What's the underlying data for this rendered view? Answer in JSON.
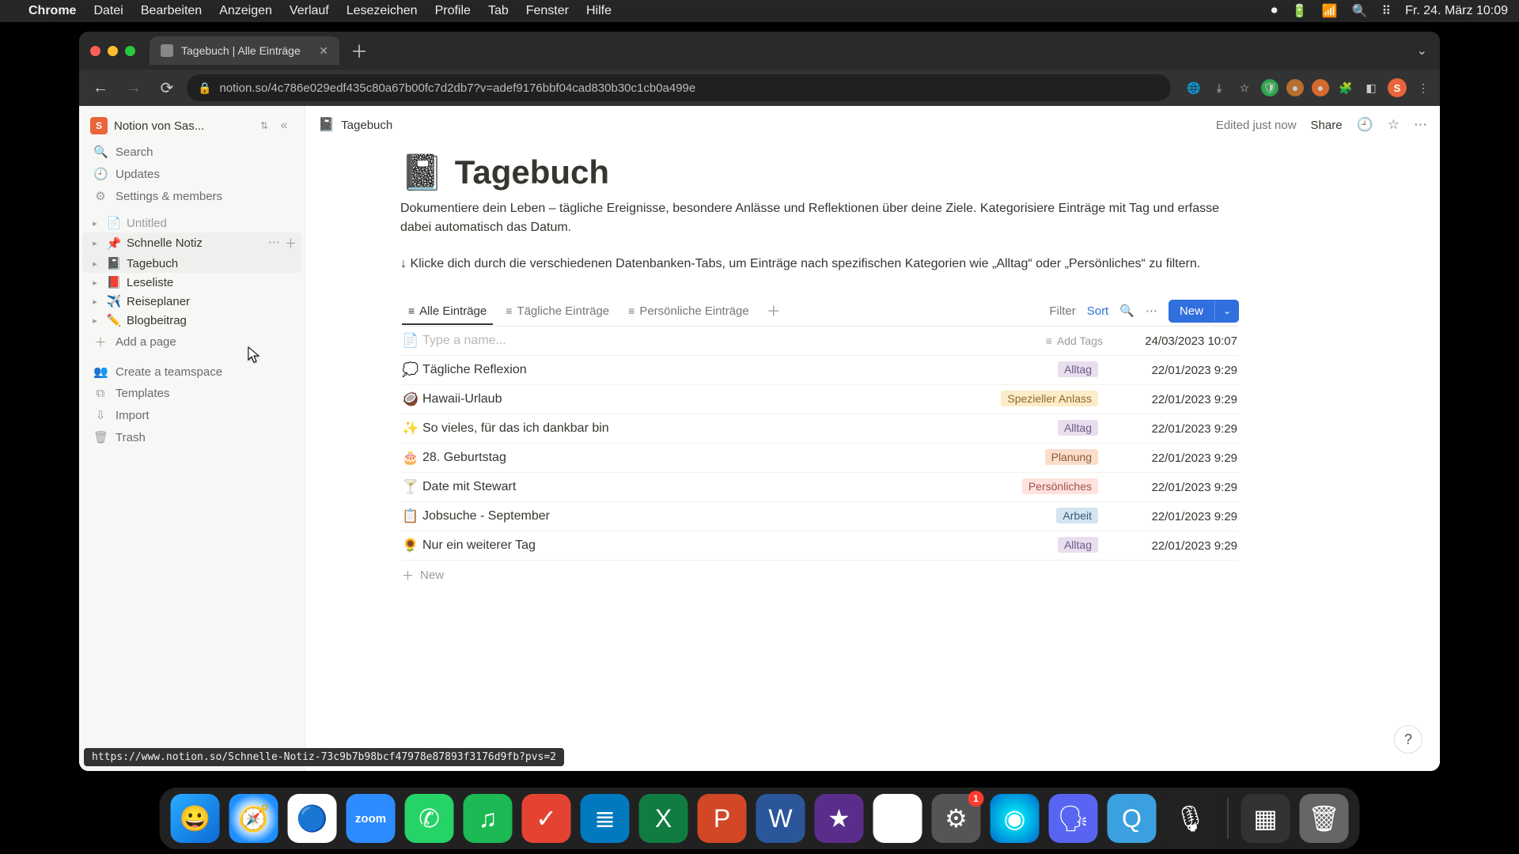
{
  "menubar": {
    "app": "Chrome",
    "items": [
      "Datei",
      "Bearbeiten",
      "Anzeigen",
      "Verlauf",
      "Lesezeichen",
      "Profile",
      "Tab",
      "Fenster",
      "Hilfe"
    ],
    "clock": "Fr. 24. März  10:09"
  },
  "browser": {
    "tab_title": "Tagebuch | Alle Einträge",
    "url": "notion.so/4c786e029edf435c80a67b00fc7d2db7?v=adef9176bbf04cad830b30c1cb0a499e",
    "avatar_initial": "S"
  },
  "workspace": {
    "badge": "S",
    "name": "Notion von Sas..."
  },
  "sidebar_top": [
    {
      "icon": "🔍",
      "label": "Search"
    },
    {
      "icon": "🕘",
      "label": "Updates"
    },
    {
      "icon": "⚙",
      "label": "Settings & members"
    }
  ],
  "sidebar_pages": [
    {
      "icon": "📄",
      "label": "Untitled",
      "muted": true
    },
    {
      "icon": "📌",
      "label": "Schnelle Notiz",
      "hovered": true
    },
    {
      "icon": "📓",
      "label": "Tagebuch",
      "active": true
    },
    {
      "icon": "📕",
      "label": "Leseliste"
    },
    {
      "icon": "✈️",
      "label": "Reiseplaner"
    },
    {
      "icon": "✏️",
      "label": "Blogbeitrag"
    }
  ],
  "sidebar_add_page": "Add a page",
  "sidebar_bottom": [
    {
      "icon": "👥",
      "label": "Create a teamspace"
    },
    {
      "icon": "⧉",
      "label": "Templates"
    },
    {
      "icon": "⇩",
      "label": "Import"
    },
    {
      "icon": "🗑",
      "label": "Trash"
    }
  ],
  "sidebar_newpage": "New page",
  "topbar": {
    "crumb_icon": "📓",
    "crumb": "Tagebuch",
    "edited": "Edited just now",
    "share": "Share"
  },
  "page": {
    "emoji": "📓",
    "title": "Tagebuch",
    "desc": "Dokumentiere dein Leben – tägliche Ereignisse, besondere Anlässe und Reflektionen über deine Ziele. Kategorisiere Einträge mit Tag und erfasse dabei automatisch das Datum.",
    "tip": "↓ Klicke dich durch die verschiedenen Datenbanken-Tabs, um Einträge nach spezifischen Kategorien wie „Alltag“ oder „Persönliches“ zu filtern."
  },
  "db": {
    "tabs": [
      {
        "icon": "≡",
        "label": "Alle Einträge",
        "active": true
      },
      {
        "icon": "≡",
        "label": "Tägliche Einträge"
      },
      {
        "icon": "≡",
        "label": "Persönliche Einträge"
      }
    ],
    "controls": {
      "filter": "Filter",
      "sort": "Sort",
      "new": "New"
    },
    "placeholder": "Type a name...",
    "addtags": "Add Tags",
    "newrow": "New",
    "rows": [
      {
        "icon": "📄",
        "title": "",
        "tags": [],
        "date": "24/03/2023 10:07",
        "placeholder": true
      },
      {
        "icon": "💭",
        "title": "Tägliche Reflexion",
        "tags": [
          "Alltag"
        ],
        "date": "22/01/2023 9:29"
      },
      {
        "icon": "🥥",
        "title": "Hawaii-Urlaub",
        "tags": [
          "Spezieller Anlass"
        ],
        "date": "22/01/2023 9:29"
      },
      {
        "icon": "✨",
        "title": "So vieles, für das ich dankbar bin",
        "tags": [
          "Alltag"
        ],
        "date": "22/01/2023 9:29"
      },
      {
        "icon": "🎂",
        "title": "28. Geburtstag",
        "tags": [
          "Planung"
        ],
        "date": "22/01/2023 9:29"
      },
      {
        "icon": "🍸",
        "title": "Date mit Stewart",
        "tags": [
          "Persönliches"
        ],
        "date": "22/01/2023 9:29"
      },
      {
        "icon": "📋",
        "title": "Jobsuche - September",
        "tags": [
          "Arbeit"
        ],
        "date": "22/01/2023 9:29"
      },
      {
        "icon": "🌻",
        "title": "Nur ein weiterer Tag",
        "tags": [
          "Alltag"
        ],
        "date": "22/01/2023 9:29"
      }
    ]
  },
  "status_url": "https://www.notion.so/Schnelle-Notiz-73c9b7b98bcf47978e87893f3176d9fb?pvs=2",
  "dock": [
    {
      "name": "finder",
      "color": "linear-gradient(135deg,#29abff,#0c6bd6)",
      "glyph": "😀"
    },
    {
      "name": "safari",
      "color": "radial-gradient(circle,#fff 30%,#1e90ff 70%)",
      "glyph": "🧭"
    },
    {
      "name": "chrome",
      "color": "#fff",
      "glyph": "🔵"
    },
    {
      "name": "zoom",
      "color": "#2d8cff",
      "glyph": "zoom",
      "text": true
    },
    {
      "name": "whatsapp",
      "color": "#25d366",
      "glyph": "✆"
    },
    {
      "name": "spotify",
      "color": "#1db954",
      "glyph": "♫"
    },
    {
      "name": "todoist",
      "color": "#e44332",
      "glyph": "✓"
    },
    {
      "name": "trello",
      "color": "#0079bf",
      "glyph": "≣"
    },
    {
      "name": "excel",
      "color": "#107c41",
      "glyph": "X"
    },
    {
      "name": "powerpoint",
      "color": "#d24726",
      "glyph": "P"
    },
    {
      "name": "word",
      "color": "#2b579a",
      "glyph": "W"
    },
    {
      "name": "imovie",
      "color": "#5a2d8c",
      "glyph": "★"
    },
    {
      "name": "drive",
      "color": "#fff",
      "glyph": "▲"
    },
    {
      "name": "settings",
      "color": "#555",
      "glyph": "⚙",
      "badge": "1"
    },
    {
      "name": "siri",
      "color": "radial-gradient(circle,#0ff,#06c)",
      "glyph": "◉"
    },
    {
      "name": "discord",
      "color": "#5865f2",
      "glyph": "🗣"
    },
    {
      "name": "quicktime",
      "color": "#3aa0e0",
      "glyph": "Q"
    },
    {
      "name": "voice",
      "color": "#222",
      "glyph": "🎙"
    },
    {
      "name": "sep"
    },
    {
      "name": "missioncontrol",
      "color": "#333",
      "glyph": "▦"
    },
    {
      "name": "trash",
      "color": "#666",
      "glyph": "🗑"
    }
  ]
}
